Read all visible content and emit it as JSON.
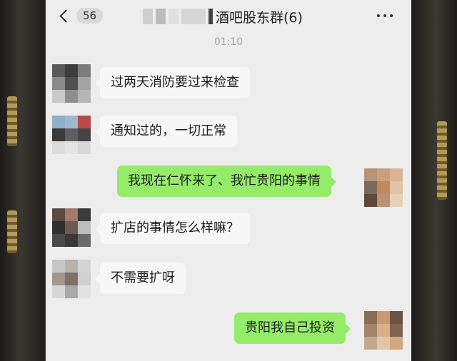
{
  "header": {
    "unread_count": "56",
    "group_title": "酒吧股东群(6)",
    "back_icon": "chevron-left-icon",
    "more_icon": "more-dots-icon"
  },
  "chat": {
    "timestamp": "01:10",
    "messages": [
      {
        "side": "left",
        "text": "过两天消防要过来检查"
      },
      {
        "side": "left",
        "text": "通知过的，一切正常"
      },
      {
        "side": "right",
        "text": "我现在仁怀来了、我忙贵阳的事情"
      },
      {
        "side": "left",
        "text": "扩店的事情怎么样嘛？"
      },
      {
        "side": "left",
        "text": "不需要扩呀"
      },
      {
        "side": "right",
        "text": "贵阳我自己投资"
      }
    ]
  },
  "colors": {
    "chat_bg": "#ededed",
    "incoming_bubble": "#f7f7f7",
    "outgoing_bubble": "#95ec69",
    "timestamp_text": "#a8a8a8"
  }
}
